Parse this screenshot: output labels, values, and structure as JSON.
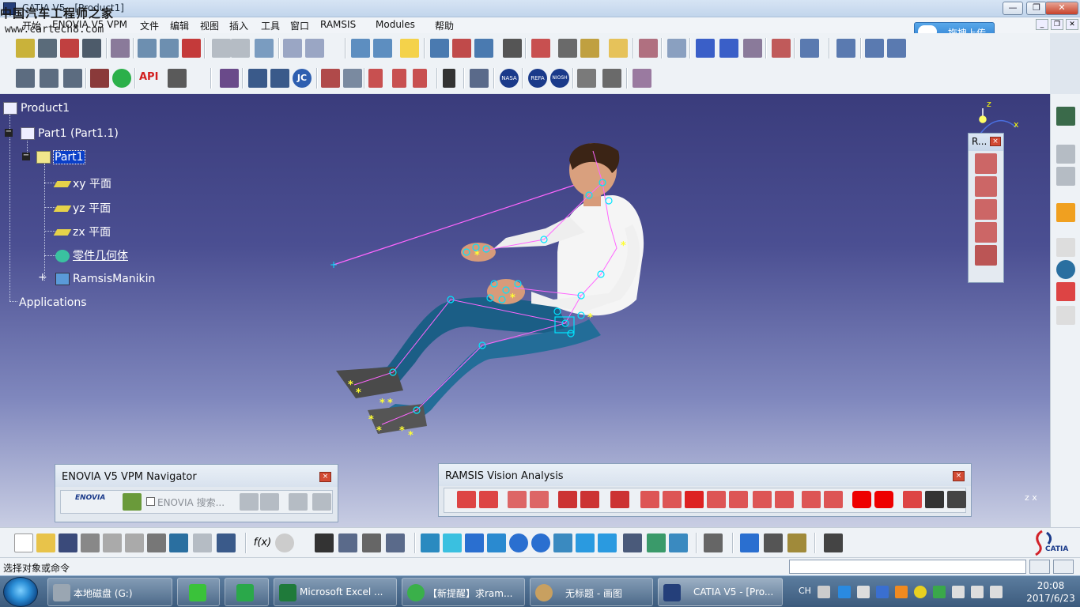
{
  "window": {
    "title": "CATIA V5 - [Product1]",
    "watermark": "中国汽车工程师之家",
    "watermark_url": "www.cartech8.com",
    "min_label": "—",
    "max_label": "❐",
    "close_label": "✕"
  },
  "menu": {
    "items": [
      "开始",
      "ENOVIA V5 VPM",
      "文件",
      "编辑",
      "视图",
      "插入",
      "工具",
      "窗口",
      "RAMSIS",
      "Modules",
      "帮助"
    ]
  },
  "upload_button": {
    "label": "拖拽上传"
  },
  "tree": {
    "root": "Product1",
    "part_instance": "Part1 (Part1.1)",
    "part": "Part1",
    "plane_xy": "xy 平面",
    "plane_yz": "yz 平面",
    "plane_zx": "zx 平面",
    "body": "零件几何体",
    "manikin": "RamsisManikin",
    "applications": "Applications"
  },
  "compass": {
    "z_label": "z",
    "x_label": "x",
    "axis_corner_label": "z x"
  },
  "floating_toolbar": {
    "title": "R...",
    "close": "×"
  },
  "enovia_panel": {
    "title": "ENOVIA V5 VPM Navigator",
    "logo_text": "ENOVIA",
    "search_label": "ENOVIA 搜索...",
    "close": "×"
  },
  "ramsis_panel": {
    "title": "RAMSIS Vision Analysis",
    "close": "×"
  },
  "toolbar1_api_label": "API",
  "toolbar2_labels": {
    "jc": "JC",
    "nasa": "NASA",
    "refa": "REFA",
    "niosh": "NIOSH"
  },
  "catia_logo": "CATIA",
  "statusbar": {
    "text": "选择对象或命令"
  },
  "taskbar": {
    "items": [
      {
        "label": "本地磁盘 (G:)"
      },
      {
        "label": "Microsoft Excel ..."
      },
      {
        "label": "【新提醒】求ram..."
      },
      {
        "label": "无标题 - 画图"
      },
      {
        "label": "CATIA V5 - [Pro..."
      }
    ],
    "tray_lang": "CH",
    "time": "20:08",
    "date": "2017/6/23"
  },
  "colors": {
    "viewport_top": "#3a3c7c",
    "viewport_bottom": "#c8cde3",
    "selection": "#0a3fc8",
    "skeleton": "#ff66ff",
    "joint": "#00e5ff",
    "marker": "#ffff33"
  }
}
